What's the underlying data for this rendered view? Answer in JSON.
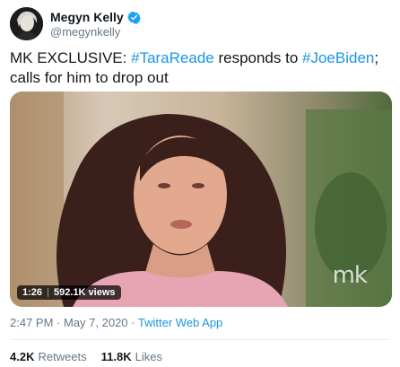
{
  "tweet": {
    "author": {
      "name": "Megyn Kelly",
      "handle": "@megynkelly",
      "verified": true,
      "verified_color": "#1da1f2"
    },
    "text_parts": [
      {
        "t": "MK EXCLUSIVE: ",
        "tag": false
      },
      {
        "t": "#TaraReade",
        "tag": true
      },
      {
        "t": " responds to ",
        "tag": false
      },
      {
        "t": "#JoeBiden",
        "tag": true
      },
      {
        "t": "; calls for him to drop out",
        "tag": false
      }
    ],
    "media": {
      "duration": "1:26",
      "views": "592.1K views",
      "watermark": "mk"
    },
    "time": "2:47 PM",
    "date": "May 7, 2020",
    "separator": " · ",
    "source": "Twitter Web App",
    "retweets_count": "4.2K",
    "retweets_label": "Retweets",
    "likes_count": "11.8K",
    "likes_label": "Likes",
    "hashtag_color": "#1b95e0"
  }
}
